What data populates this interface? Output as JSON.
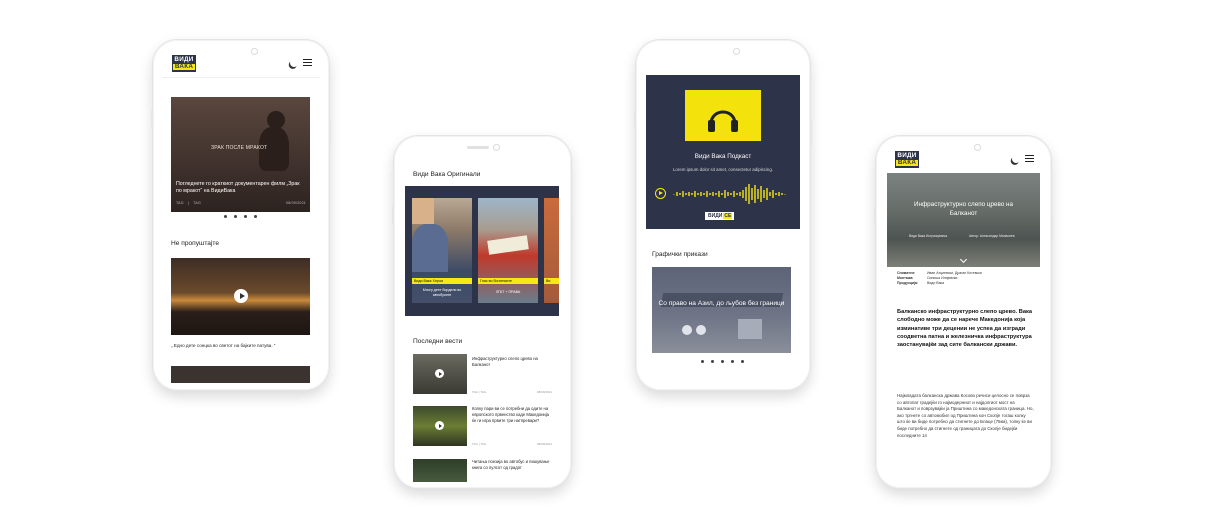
{
  "brand": {
    "logo_line1": "ВИДИ",
    "logo_line2": "ВАКА"
  },
  "phone1": {
    "hero_overlay": "ЗРАК ПОСЛЕ МРАКОТ",
    "hero_title": "Погледнете го краткиот документарен филм „Зрак по мракот“ на ВидиВака",
    "hero_tag1": "TAG",
    "hero_tag2": "TAG",
    "hero_date": "08/09/2021",
    "section_title": "Не пропуштајте",
    "video_caption": "„ Едно дете сонцка во светот на бајките патува. “"
  },
  "phone2": {
    "originals_title": "Види Вака Оригинали",
    "cards": [
      {
        "tag": "Види Вака Херои",
        "caption": "Многу дете бордели во автобусите"
      },
      {
        "tag": "Глас во богатниите",
        "caption": "ЛГБТ + ПРАВА"
      },
      {
        "tag": "Ви",
        "caption": ""
      }
    ],
    "news_title": "Последни вести",
    "news": [
      {
        "title": "Инфраструктурно слепо црево на Балканот",
        "tag1": "TAG",
        "tag2": "TAG",
        "date": "08/09/2021"
      },
      {
        "title": "Колку пари ви се потребни да одите на европското првенство каде Македонија ќе ги игра првите три натпревари?",
        "tag1": "TAG",
        "tag2": "TAG",
        "date": "08/09/2021"
      },
      {
        "title": "Читања поезија во автобус и пишување книга со пулсот од градот",
        "tag1": "",
        "tag2": "",
        "date": ""
      }
    ]
  },
  "phone3": {
    "podcast_title": "Види Вака Подкаст",
    "podcast_sub": "Lorem ipsum dolor sit amet, consectetur adipiscing.",
    "brand_mini_1": "ВИДИ",
    "brand_mini_2": "СЕ",
    "graphics_title": "Графички прикази",
    "graphic_caption": "Со право на Азил, до љубов без граници"
  },
  "phone4": {
    "article_title": "Инфраструктурно слепо црево на Балканот",
    "author_left": "Види Вака Истражувања",
    "author_right": "Автор: Александар Манасиев",
    "credits": [
      {
        "label": "Снимател:",
        "value": "Иван Атциевски, Драган Котевски"
      },
      {
        "label": "Монтажа:",
        "value": "Синиша Илијевски"
      },
      {
        "label": "Продукција:",
        "value": "Види Вака"
      }
    ],
    "lead": "Балканско инфраструктурно слепо црево. Вака слободно може да се нарече Македонија која изминативе три децении не успеа да изгради соодветна патна и железничка инфраструктура заостанувајќи зад сите балкански држави.",
    "body": "Најмладата балканска држава Косово речиси целосно се поврза со автопат градејќи го најмодерниот и најдолгиот мост на Балканот и поврзувајќи ја Приштина со македонската граница. Но, ако тргнете со автомобил од Приштина кон Скопје тогаш колку што ќе ви биде потребно да стигнете до Блаце (75км), толку ќе ви биде потребно да стигнете од границата до Скопје бидејќи последните 14"
  },
  "colors": {
    "navy": "#2d3348",
    "yellow": "#f6e717"
  }
}
